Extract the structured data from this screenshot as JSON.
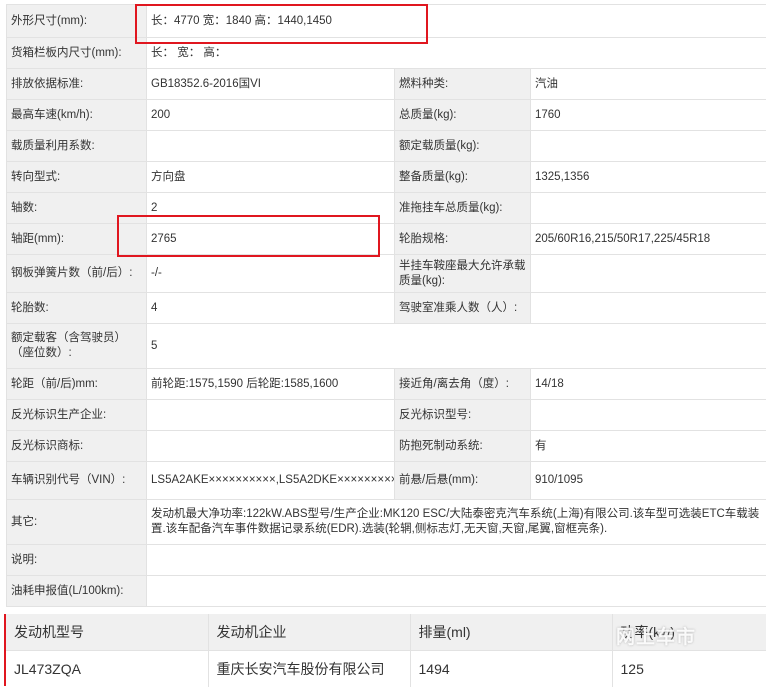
{
  "spec_rows": [
    {
      "label": "外形尺寸(mm):",
      "value": "长：4770 宽：1840 高：1440,1450",
      "full": true
    },
    {
      "label": "货箱栏板内尺寸(mm):",
      "value": "长： 宽： 高：",
      "full": true
    },
    {
      "label": "排放依据标准:",
      "value": "GB18352.6-2016国VI",
      "label2": "燃料种类:",
      "value2": "汽油"
    },
    {
      "label": "最高车速(km/h):",
      "value": "200",
      "label2": "总质量(kg):",
      "value2": "1760"
    },
    {
      "label": "载质量利用系数:",
      "value": "",
      "label2": "额定载质量(kg):",
      "value2": ""
    },
    {
      "label": "转向型式:",
      "value": "方向盘",
      "label2": "整备质量(kg):",
      "value2": "1325,1356"
    },
    {
      "label": "轴数:",
      "value": "2",
      "label2": "准拖挂车总质量(kg):",
      "value2": ""
    },
    {
      "label": "轴距(mm):",
      "value": "2765",
      "label2": "轮胎规格:",
      "value2": "205/60R16,215/50R17,225/45R18"
    },
    {
      "label": "钢板弹簧片数（前/后）:",
      "value": "-/-",
      "label2": "半挂车鞍座最大允许承载质量(kg):",
      "value2": ""
    },
    {
      "label": "轮胎数:",
      "value": "4",
      "label2": "驾驶室准乘人数（人）:",
      "value2": ""
    },
    {
      "label": "额定载客（含驾驶员）（座位数）:",
      "value": "5",
      "full": true
    },
    {
      "label": "轮距（前/后)mm:",
      "value": "前轮距:1575,1590 后轮距:1585,1600",
      "label2": "接近角/离去角（度）:",
      "value2": "14/18"
    },
    {
      "label": "反光标识生产企业:",
      "value": "",
      "label2": "反光标识型号:",
      "value2": ""
    },
    {
      "label": "反光标识商标:",
      "value": "",
      "label2": "防抱死制动系统:",
      "value2": "有"
    },
    {
      "label": "车辆识别代号（VIN）:",
      "value": "LS5A2AKE××××××××××,LS5A2DKE××××××××××",
      "label2": "前悬/后悬(mm):",
      "value2": "910/1095"
    },
    {
      "label": "其它:",
      "value": "发动机最大净功率:122kW.ABS型号/生产企业:MK120 ESC/大陆泰密克汽车系统(上海)有限公司.该车型可选装ETC车载装置.该车配备汽车事件数据记录系统(EDR).选装(轮辋,侧标志灯,无天窗,天窗,尾翼,窗框亮条).",
      "full": true
    },
    {
      "label": "说明:",
      "value": "",
      "full": true
    },
    {
      "label": "油耗申报值(L/100km):",
      "value": "",
      "full": true
    }
  ],
  "engine_table": {
    "headers": [
      "发动机型号",
      "发动机企业",
      "排量(ml)",
      "功率(kw)"
    ],
    "row": [
      "JL473ZQA",
      "重庆长安汽车股份有限公司",
      "1494",
      "125"
    ]
  },
  "watermark": "网上车市",
  "colors": {
    "highlight": "#e0161f",
    "label_bg": "#f0f0f0",
    "border": "#e2e2e2"
  }
}
